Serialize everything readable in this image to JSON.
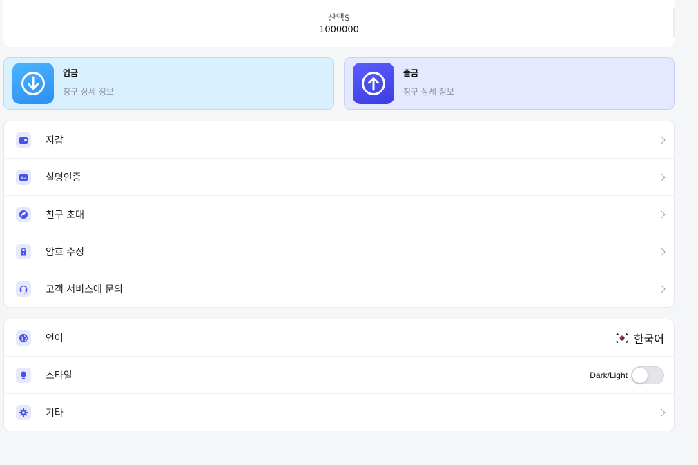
{
  "balance": {
    "label": "잔액$",
    "value": "1000000"
  },
  "actions": [
    {
      "title": "입금",
      "subtitle": "청구 상세 정보",
      "icon": "arrow-down-circle-icon",
      "color": "#2c8ef3"
    },
    {
      "title": "출금",
      "subtitle": "청구 상세 정보",
      "icon": "arrow-up-circle-icon",
      "color": "#3c3de0"
    }
  ],
  "menu_main": [
    {
      "label": "지갑",
      "icon": "wallet-icon"
    },
    {
      "label": "실명인증",
      "icon": "id-card-icon"
    },
    {
      "label": "친구 초대",
      "icon": "share-icon"
    },
    {
      "label": "암호 수정",
      "icon": "lock-icon"
    },
    {
      "label": "고객 서비스에 문의",
      "icon": "headset-icon"
    }
  ],
  "menu_settings": {
    "language": {
      "label": "언어",
      "value": "한국어",
      "icon": "globe-icon",
      "flag": "korea-flag-icon"
    },
    "style": {
      "label": "스타일",
      "toggle_label": "Dark/Light",
      "icon": "bulb-icon",
      "toggle_on": false
    },
    "other": {
      "label": "기타",
      "icon": "gear-icon"
    }
  },
  "colors": {
    "accent": "#4a4fe6",
    "icon_bg": "#e6e9fb"
  }
}
